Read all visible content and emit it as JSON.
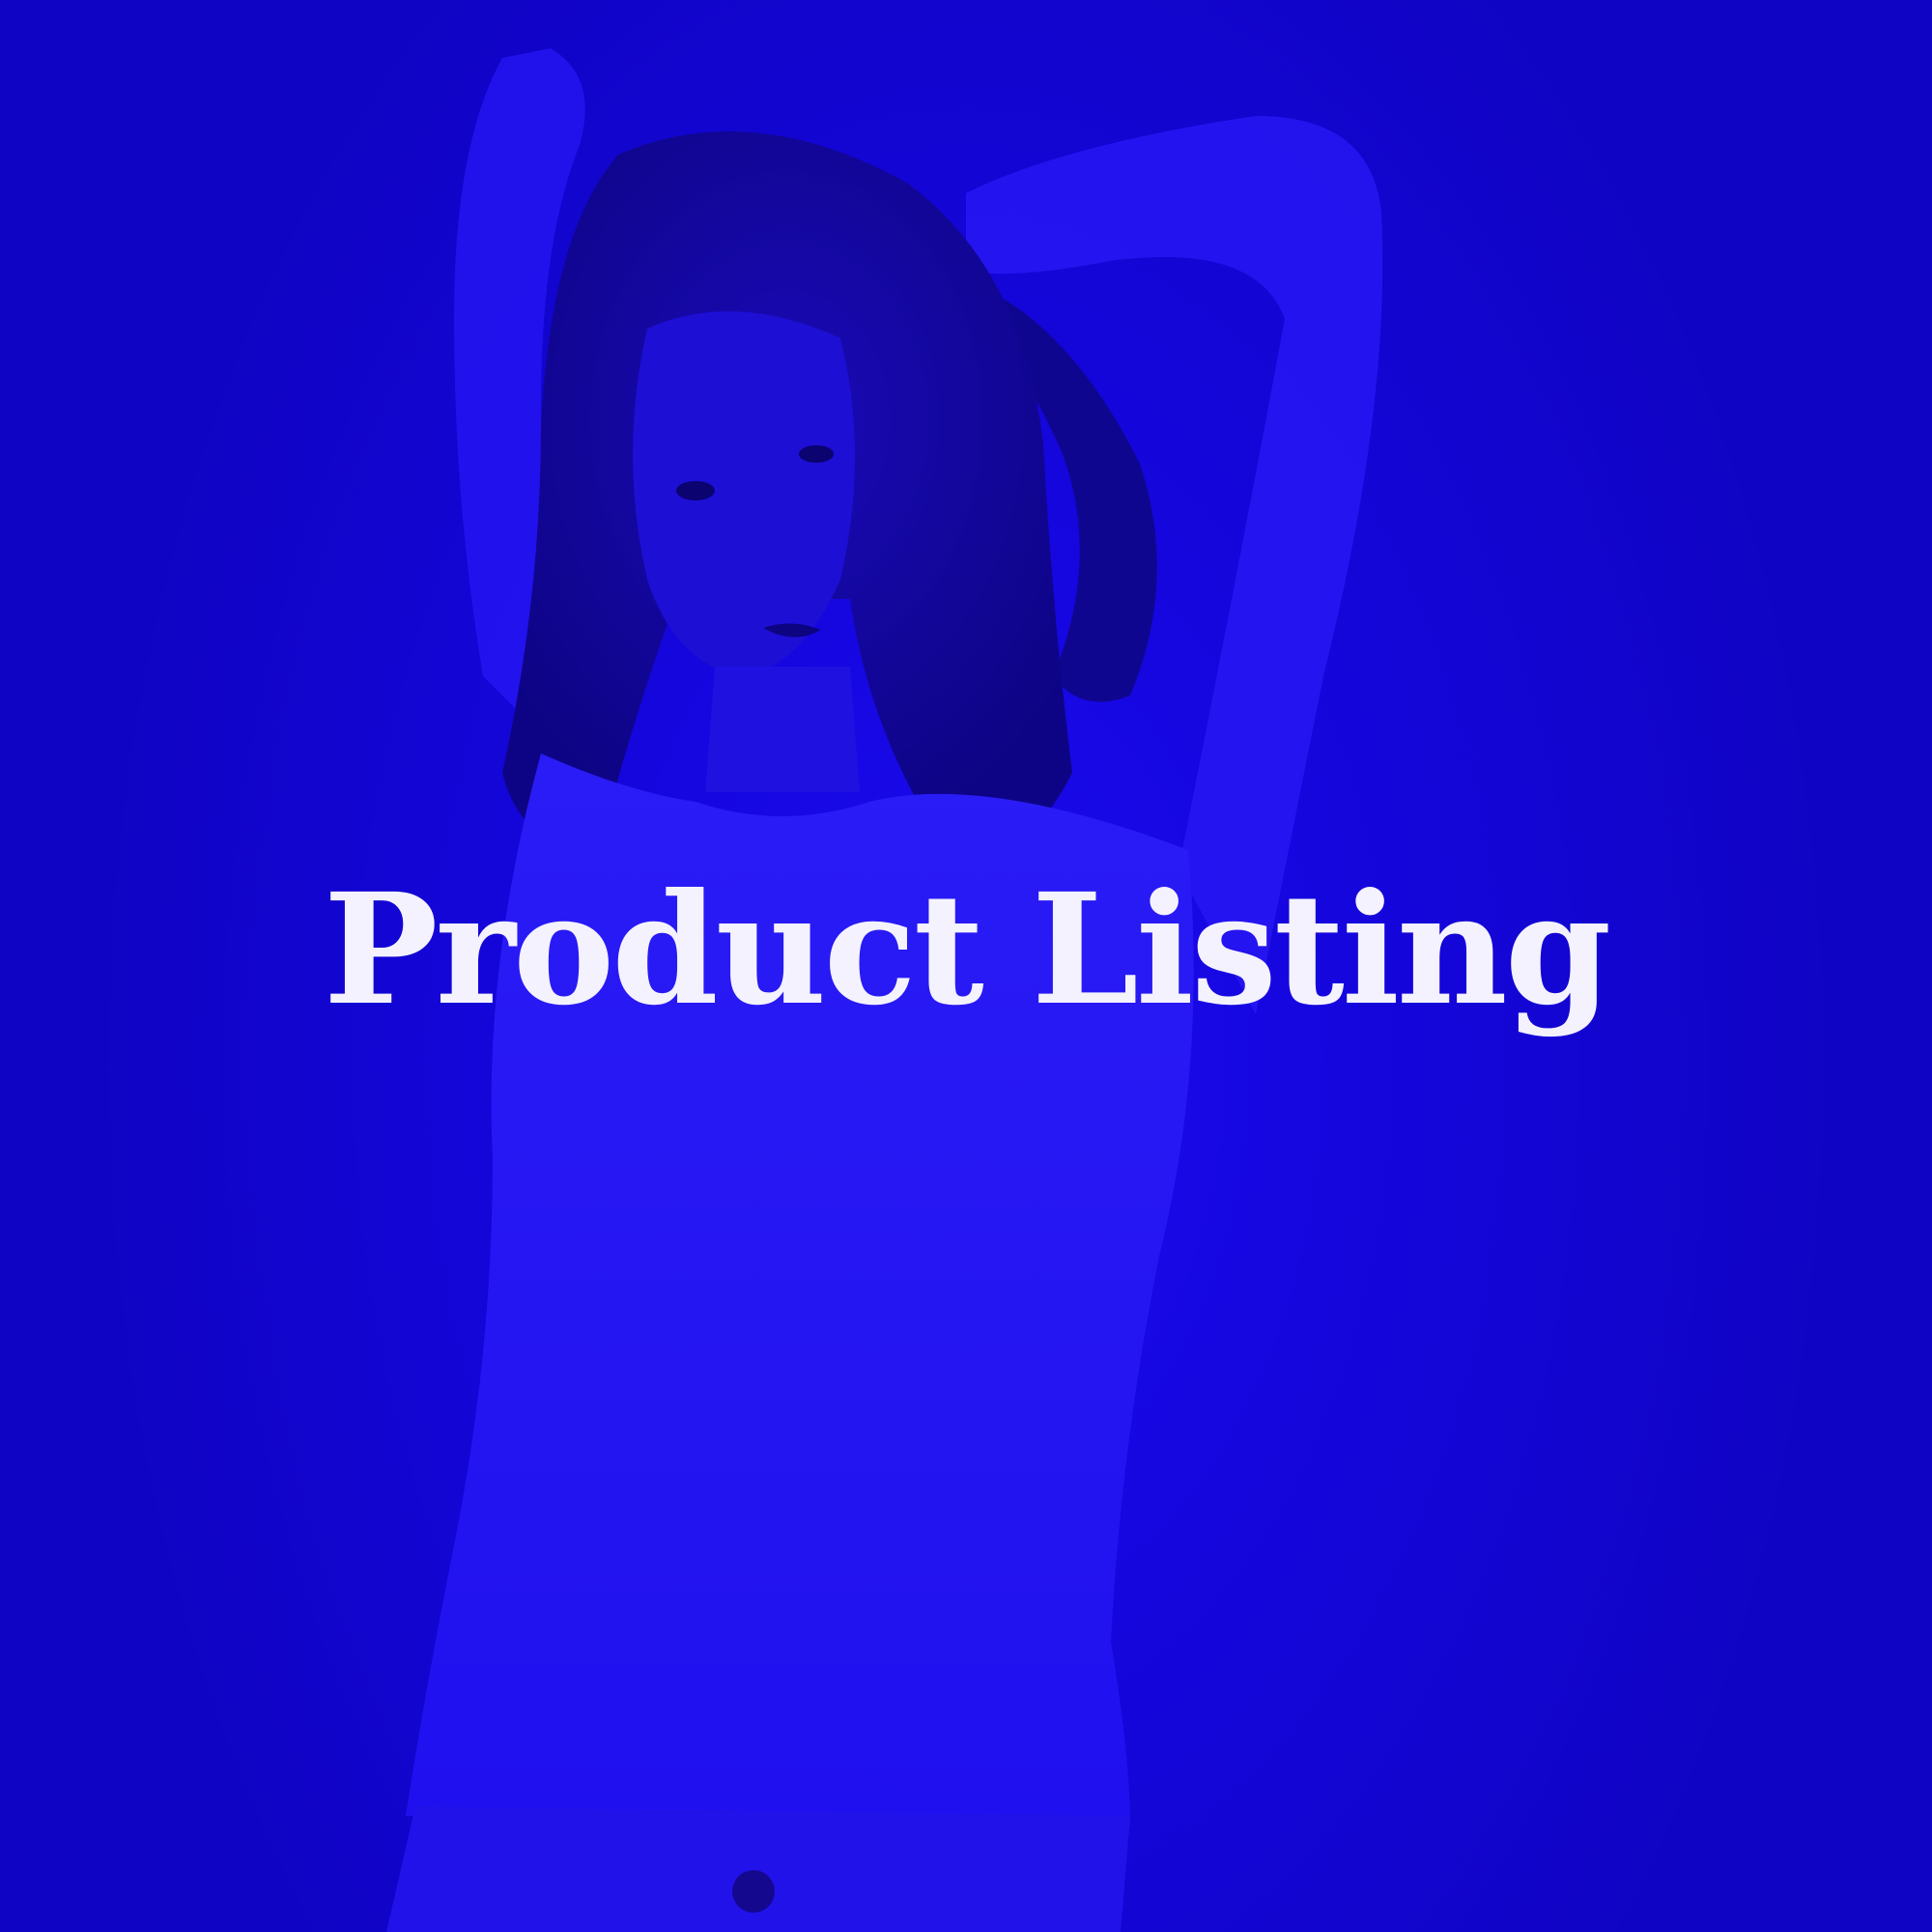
{
  "hero": {
    "title": "Product Listing",
    "overlay_color": "#1406d6",
    "text_color": "#f4f2ff",
    "photo_subject": "model-in-fitted-long-sleeve-top-arms-raised"
  }
}
